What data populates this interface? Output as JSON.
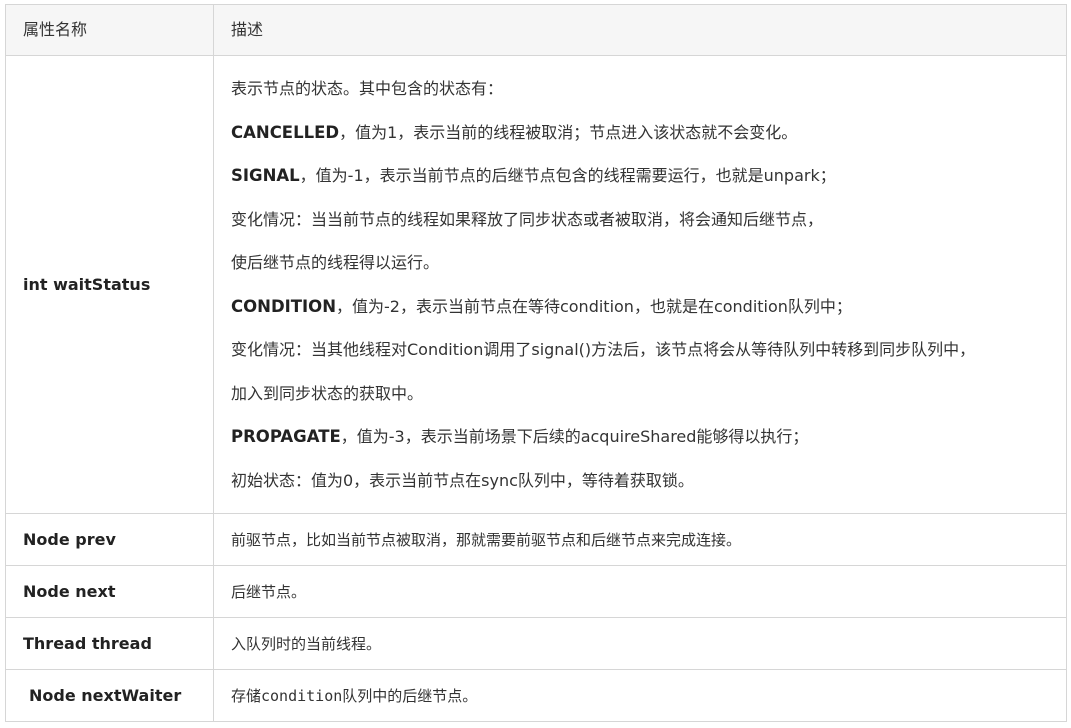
{
  "header": {
    "col1": "属性名称",
    "col2": "描述"
  },
  "wait_status": {
    "name": "int waitStatus",
    "lines": [
      {
        "bold": "",
        "text": "表示节点的状态。其中包含的状态有："
      },
      {
        "bold": "CANCELLED",
        "text": "，值为1，表示当前的线程被取消；节点进入该状态就不会变化。"
      },
      {
        "bold": "SIGNAL",
        "text": "，值为-1，表示当前节点的后继节点包含的线程需要运行，也就是unpark；"
      },
      {
        "bold": "",
        "text": "变化情况：当当前节点的线程如果释放了同步状态或者被取消，将会通知后继节点，"
      },
      {
        "bold": "",
        "text": "使后继节点的线程得以运行。"
      },
      {
        "bold": "CONDITION",
        "text": "，值为-2，表示当前节点在等待condition，也就是在condition队列中；"
      },
      {
        "bold": "",
        "text": "变化情况：当其他线程对Condition调用了signal()方法后，该节点将会从等待队列中转移到同步队列中，"
      },
      {
        "bold": "",
        "text": "加入到同步状态的获取中。"
      },
      {
        "bold": "PROPAGATE",
        "text": "，值为-3，表示当前场景下后续的acquireShared能够得以执行；"
      },
      {
        "bold": "",
        "text": "初始状态：值为0，表示当前节点在sync队列中，等待着获取锁。"
      }
    ]
  },
  "rows": [
    {
      "name": "Node prev",
      "desc": "前驱节点，比如当前节点被取消，那就需要前驱节点和后继节点来完成连接。"
    },
    {
      "name": "Node next",
      "desc": "后继节点。"
    },
    {
      "name": "Thread thread",
      "desc": "入队列时的当前线程。"
    },
    {
      "name": "Node nextWaiter",
      "desc": "存储condition队列中的后继节点。"
    }
  ]
}
